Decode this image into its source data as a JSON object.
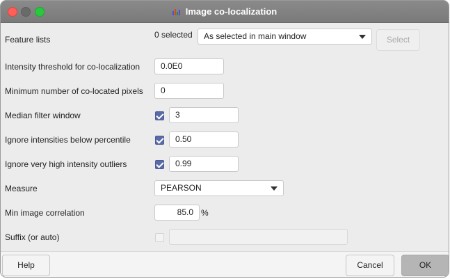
{
  "window": {
    "title": "Image co-localization",
    "title_icon": "bar-chart-icon"
  },
  "rows": {
    "feature_lists": {
      "label": "Feature lists",
      "selected_count": "0 selected",
      "combo_value": "As selected in main window",
      "select_button": "Select"
    },
    "intensity_threshold": {
      "label": "Intensity threshold for co-localization",
      "value": "0.0E0"
    },
    "min_colocated_pixels": {
      "label": "Minimum number of co-located pixels",
      "value": "0"
    },
    "median_filter": {
      "label": "Median filter window",
      "checked": true,
      "value": "3"
    },
    "ignore_below_percentile": {
      "label": "Ignore intensities below percentile",
      "checked": true,
      "value": "0.50"
    },
    "ignore_outliers": {
      "label": "Ignore very high intensity outliers",
      "checked": true,
      "value": "0.99"
    },
    "measure": {
      "label": "Measure",
      "value": "PEARSON"
    },
    "min_correlation": {
      "label": "Min image correlation",
      "value": "85.0",
      "unit": "%"
    },
    "suffix": {
      "label": "Suffix (or auto)",
      "checked": false,
      "value": ""
    }
  },
  "footer": {
    "help": "Help",
    "cancel": "Cancel",
    "ok": "OK"
  },
  "colors": {
    "titlebar": "#7f7f7f",
    "checkbox_accent": "#5b6ba8",
    "close": "#ff5f57",
    "maximize": "#28c840"
  }
}
